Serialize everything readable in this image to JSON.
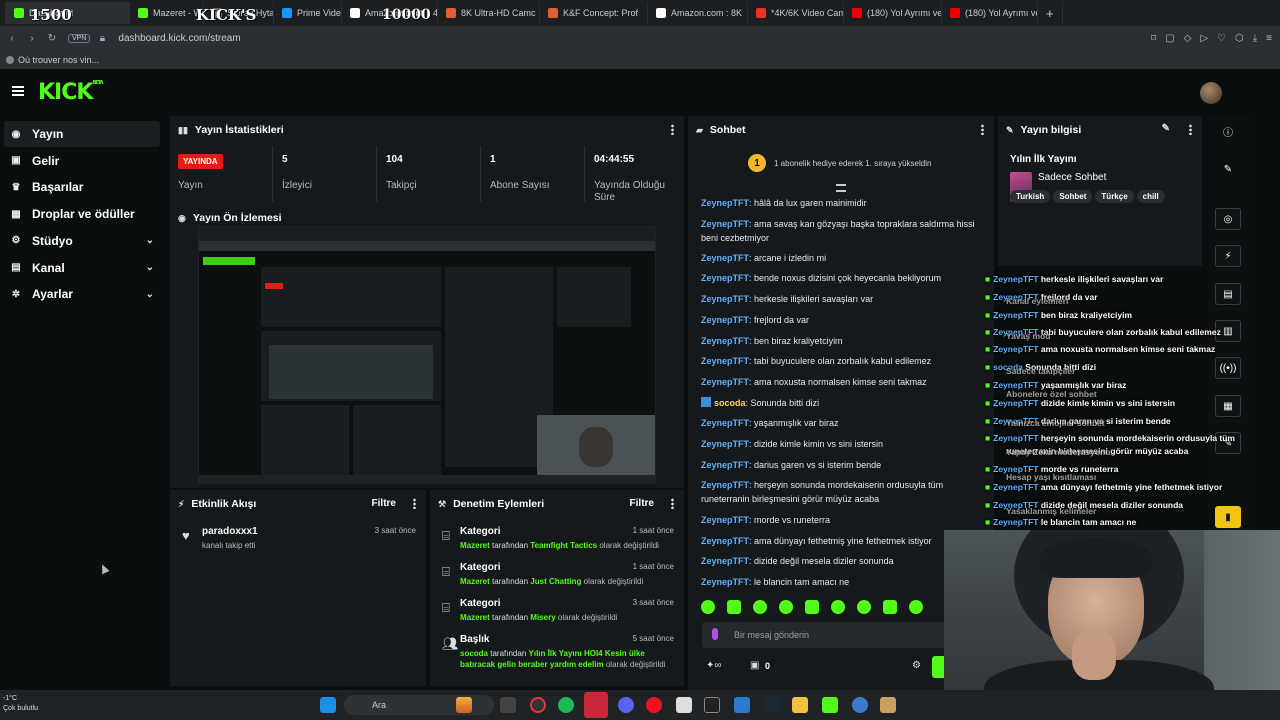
{
  "browser": {
    "tabs": [
      {
        "label": "Dashboard",
        "fav": "#53fc18",
        "active": true
      },
      {
        "label": "Mazeret - Wat",
        "fav": "#53fc18"
      },
      {
        "label": "Store | Hytale",
        "fav": "#666"
      },
      {
        "label": "Prime Video",
        "fav": "#1a98ff"
      },
      {
        "label": "Amazon.com.tr : 4",
        "fav": "#fff"
      },
      {
        "label": "8K Ultra-HD Camc",
        "fav": "#e06030"
      },
      {
        "label": "K&F Concept: Prof",
        "fav": "#e06030"
      },
      {
        "label": "Amazon.com : 8K",
        "fav": "#fff"
      },
      {
        "label": "*4K/6K Video Cam",
        "fav": "#e32"
      },
      {
        "label": "(180) Yol Ayrımı ve",
        "fav": "#e00"
      },
      {
        "label": "(180) Yol Ayrımı ve",
        "fav": "#e00"
      }
    ],
    "overlay_counts": {
      "left": "1500",
      "brand": "KICK'S",
      "middle": "10000"
    },
    "new_tab": "+",
    "url": "dashboard.kick.com/stream",
    "vpn": "VPN",
    "bookmark": "Où trouver nos vin..."
  },
  "header": {
    "logo": "KICK",
    "logo_sup": "BETA"
  },
  "sidenav": [
    {
      "label": "Yayın",
      "icon": "broadcast-icon",
      "glyph": "◉",
      "active": true
    },
    {
      "label": "Gelir",
      "icon": "wallet-icon",
      "glyph": "▣"
    },
    {
      "label": "Başarılar",
      "icon": "trophy-icon",
      "glyph": "♛"
    },
    {
      "label": "Droplar ve ödüller",
      "icon": "gift-icon",
      "glyph": "▦"
    },
    {
      "label": "Stüdyo",
      "icon": "studio-icon",
      "glyph": "⚙",
      "chev": true
    },
    {
      "label": "Kanal",
      "icon": "channel-icon",
      "glyph": "▤",
      "chev": true
    },
    {
      "label": "Ayarlar",
      "icon": "settings-icon",
      "glyph": "✲",
      "chev": true
    }
  ],
  "stats": {
    "title": "Yayın İstatistikleri",
    "live": "YAYINDA",
    "live_label": "Yayın",
    "items": [
      {
        "value": "5",
        "label": "İzleyici"
      },
      {
        "value": "104",
        "label": "Takipçi"
      },
      {
        "value": "1",
        "label": "Abone Sayısı"
      },
      {
        "value": "04:44:55",
        "label": "Yayında Olduğu Süre"
      }
    ]
  },
  "preview": {
    "title": "Yayın Ön İzlemesi"
  },
  "activity": {
    "title": "Etkinlik Akışı",
    "filter": "Filtre",
    "items": [
      {
        "user": "paradoxxx1",
        "text": "kanalı takip etti",
        "time": "3 saat önce"
      }
    ]
  },
  "moderation": {
    "title": "Denetim Eylemleri",
    "filter": "Filtre",
    "items": [
      {
        "title": "Kategori",
        "time": "1 saat önce",
        "by": "Mazeret",
        "mid": "tarafından",
        "val": "Teamfight Tactics",
        "tail": "olarak değiştirildi"
      },
      {
        "title": "Kategori",
        "time": "1 saat önce",
        "by": "Mazeret",
        "mid": "tarafından",
        "val": "Just Chatting",
        "tail": "olarak değiştirildi"
      },
      {
        "title": "Kategori",
        "time": "3 saat önce",
        "by": "Mazeret",
        "mid": "tarafından",
        "val": "Misery",
        "tail": "olarak değiştirildi"
      },
      {
        "title": "Başlık",
        "time": "5 saat önce",
        "by": "socoda",
        "mid": "tarafından",
        "val": "Yılın İlk Yayını HOI4 Kesin ülke batıracak gelin beraber yardım edelim",
        "tail": "olarak değiştirildi"
      }
    ]
  },
  "chat": {
    "title": "Sohbet",
    "gift_badge": "1",
    "gift_text": "1 abonelik hediye ederek 1. sıraya yükseldin",
    "messages": [
      {
        "user": "ZeynepTFT",
        "text": "hâlâ da lux garen mainimidir"
      },
      {
        "user": "ZeynepTFT",
        "text": "ama savaş kan gözyaşı başka topraklara saldırma hissi beni cezbetmiyor"
      },
      {
        "user": "ZeynepTFT",
        "text": "arcane i izledin mi"
      },
      {
        "user": "ZeynepTFT",
        "text": "bende noxus dizisini çok heyecanla bekliyorum"
      },
      {
        "user": "ZeynepTFT",
        "text": "herkesle ilişkileri savaşları var"
      },
      {
        "user": "ZeynepTFT",
        "text": "frejlord da var"
      },
      {
        "user": "ZeynepTFT",
        "text": "ben biraz kraliyetciyim"
      },
      {
        "user": "ZeynepTFT",
        "text": "tabi buyuculere olan zorbalık kabul edilemez"
      },
      {
        "user": "ZeynepTFT",
        "text": "ama noxusta normalsen kimse seni takmaz"
      },
      {
        "user": "socoda",
        "text": "Sonunda bitti dizi",
        "alt": true
      },
      {
        "user": "ZeynepTFT",
        "text": "yaşanmışlık var biraz"
      },
      {
        "user": "ZeynepTFT",
        "text": "dizide kimle kimin vs sini istersin"
      },
      {
        "user": "ZeynepTFT",
        "text": "darius garen vs si isterim bende"
      },
      {
        "user": "ZeynepTFT",
        "text": "herşeyin sonunda mordekaiserin ordusuyla tüm runeterranin birleşmesini görür müyüz acaba"
      },
      {
        "user": "ZeynepTFT",
        "text": "morde vs runeterra"
      },
      {
        "user": "ZeynepTFT",
        "text": "ama dünyayı fethetmiş yine fethetmek istiyor"
      },
      {
        "user": "ZeynepTFT",
        "text": "dizide değil mesela diziler sonunda"
      },
      {
        "user": "ZeynepTFT",
        "text": "le blancin tam amacı ne"
      }
    ],
    "input_placeholder": "Bir mesaj gönderin",
    "points": "0"
  },
  "streaminfo": {
    "title": "Yayın bilgisi",
    "stream_title": "Yılın İlk Yayını",
    "category": "Sadece Sohbet",
    "tags": [
      "Turkish",
      "Sohbet",
      "Türkçe",
      "chill"
    ]
  },
  "overlay_chat": [
    {
      "user": "ZeynepTFT",
      "text": "herkesle ilişkileri savaşları var"
    },
    {
      "user": "ZeynepTFT",
      "text": "frejlord da var"
    },
    {
      "user": "ZeynepTFT",
      "text": "ben biraz kraliyetciyim"
    },
    {
      "user": "ZeynepTFT",
      "text": "tabi buyuculere olan zorbalık kabul edilemez"
    },
    {
      "user": "ZeynepTFT",
      "text": "ama noxusta normalsen kimse seni takmaz"
    },
    {
      "user": "socoda",
      "text": "Sonunda bitti dizi"
    },
    {
      "user": "ZeynepTFT",
      "text": "yaşanmışlık var biraz"
    },
    {
      "user": "ZeynepTFT",
      "text": "dizide kimle kimin vs sini istersin"
    },
    {
      "user": "ZeynepTFT",
      "text": "darius garen vs si isterim bende"
    },
    {
      "user": "ZeynepTFT",
      "text": "herşeyin sonunda mordekaiserin ordusuyla tüm"
    },
    {
      "user": "",
      "text": "runeterranin birleşmesini görür müyüz acaba"
    },
    {
      "user": "ZeynepTFT",
      "text": "morde vs runeterra"
    },
    {
      "user": "ZeynepTFT",
      "text": "ama dünyayı fethetmiş yine fethetmek istiyor"
    },
    {
      "user": "ZeynepTFT",
      "text": "dizide değil mesela diziler sonunda"
    },
    {
      "user": "ZeynepTFT",
      "text": "le blancin tam amacı ne"
    }
  ],
  "overlay_menu": [
    "Kanal eylemleri",
    "Yavaş mod",
    "Sadece takipçiler",
    "Abonelere özel sohbet",
    "Yalnızca emojiler sohbet",
    "Yapay Zeka moderasyonu",
    "Hesap yaşı kısıtlaması",
    "Yasaklanmış kelimeler"
  ],
  "taskbar": {
    "temp": "-1°C",
    "weather": "Çok bulutlu",
    "search": "Ara"
  },
  "colors": {
    "accent": "#53fc18",
    "live": "#e91916",
    "username": "#5fb2ff"
  }
}
